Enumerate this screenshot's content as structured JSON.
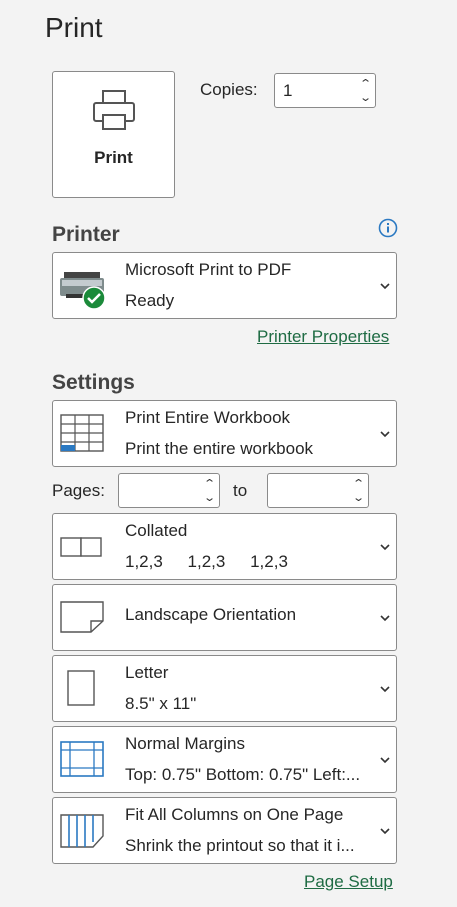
{
  "page_title": "Print",
  "print_button": {
    "label": "Print",
    "icon": "printer-icon"
  },
  "copies": {
    "label": "Copies:",
    "value": "1"
  },
  "printer": {
    "heading": "Printer",
    "name": "Microsoft Print to PDF",
    "status": "Ready",
    "properties_link": "Printer Properties"
  },
  "settings": {
    "heading": "Settings",
    "scope": {
      "title": "Print Entire Workbook",
      "subtitle": "Print the entire workbook"
    },
    "pages": {
      "label": "Pages:",
      "to_label": "to",
      "from_value": "",
      "to_value": ""
    },
    "collation": {
      "title": "Collated",
      "sequence": [
        "1,2,3",
        "1,2,3",
        "1,2,3"
      ]
    },
    "orientation": {
      "title": "Landscape Orientation"
    },
    "paper": {
      "title": "Letter",
      "subtitle": "8.5\" x 11\""
    },
    "margins": {
      "title": "Normal Margins",
      "subtitle": "Top: 0.75\" Bottom: 0.75\" Left:..."
    },
    "scaling": {
      "title": "Fit All Columns on One Page",
      "subtitle": "Shrink the printout so that it i..."
    },
    "page_setup_link": "Page Setup"
  },
  "colors": {
    "accent_green": "#1e6b43",
    "info_blue": "#2b79c2",
    "ready_check": "#1b8a3a"
  }
}
